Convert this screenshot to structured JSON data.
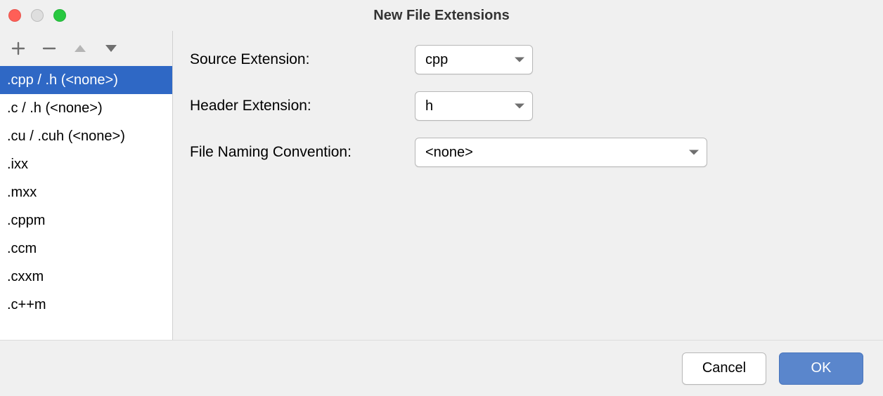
{
  "window": {
    "title": "New File Extensions"
  },
  "sidebar": {
    "items": [
      {
        "label": ".cpp / .h (<none>)",
        "selected": true
      },
      {
        "label": ".c / .h (<none>)",
        "selected": false
      },
      {
        "label": ".cu / .cuh (<none>)",
        "selected": false
      },
      {
        "label": ".ixx",
        "selected": false
      },
      {
        "label": ".mxx",
        "selected": false
      },
      {
        "label": ".cppm",
        "selected": false
      },
      {
        "label": ".ccm",
        "selected": false
      },
      {
        "label": ".cxxm",
        "selected": false
      },
      {
        "label": ".c++m",
        "selected": false
      }
    ],
    "toolbar": {
      "add_icon": "plus",
      "remove_icon": "minus",
      "up_icon": "up",
      "down_icon": "down"
    }
  },
  "form": {
    "source_ext_label": "Source Extension:",
    "source_ext_value": "cpp",
    "header_ext_label": "Header Extension:",
    "header_ext_value": "h",
    "naming_label": "File Naming Convention:",
    "naming_value": "<none>"
  },
  "footer": {
    "cancel_label": "Cancel",
    "ok_label": "OK"
  }
}
